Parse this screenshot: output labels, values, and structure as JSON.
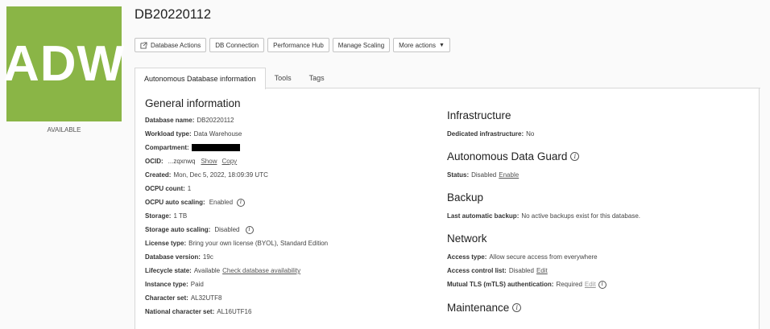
{
  "db": {
    "title": "DB20220112",
    "logo_text": "ADW",
    "lifecycle_badge": "AVAILABLE"
  },
  "toolbar": {
    "database_actions": "Database Actions",
    "db_connection": "DB Connection",
    "performance_hub": "Performance Hub",
    "manage_scaling": "Manage Scaling",
    "more_actions": "More actions"
  },
  "tabs": {
    "info": "Autonomous Database information",
    "tools": "Tools",
    "tags": "Tags"
  },
  "general": {
    "title": "General information",
    "database_name_label": "Database name:",
    "database_name": "DB20220112",
    "workload_type_label": "Workload type:",
    "workload_type": "Data Warehouse",
    "compartment_label": "Compartment:",
    "ocid_label": "OCID:",
    "ocid_value": "...zqxnwq",
    "ocid_show": "Show",
    "ocid_copy": "Copy",
    "created_label": "Created:",
    "created": "Mon, Dec 5, 2022, 18:09:39 UTC",
    "ocpu_count_label": "OCPU count:",
    "ocpu_count": "1",
    "ocpu_auto_scaling_label": "OCPU auto scaling:",
    "ocpu_auto_scaling": "Enabled",
    "storage_label": "Storage:",
    "storage": "1 TB",
    "storage_auto_scaling_label": "Storage auto scaling:",
    "storage_auto_scaling": "Disabled",
    "license_type_label": "License type:",
    "license_type": "Bring your own license (BYOL), Standard Edition",
    "database_version_label": "Database version:",
    "database_version": "19c",
    "lifecycle_state_label": "Lifecycle state:",
    "lifecycle_state": "Available",
    "check_availability": "Check database availability",
    "instance_type_label": "Instance type:",
    "instance_type": "Paid",
    "character_set_label": "Character set:",
    "character_set": "AL32UTF8",
    "national_character_set_label": "National character set:",
    "national_character_set": "AL16UTF16"
  },
  "infrastructure": {
    "title": "Infrastructure",
    "dedicated_label": "Dedicated infrastructure:",
    "dedicated": "No"
  },
  "data_guard": {
    "title": "Autonomous Data Guard",
    "status_label": "Status:",
    "status": "Disabled",
    "enable": "Enable"
  },
  "backup": {
    "title": "Backup",
    "last_label": "Last automatic backup:",
    "last": "No active backups exist for this database."
  },
  "network": {
    "title": "Network",
    "access_type_label": "Access type:",
    "access_type": "Allow secure access from everywhere",
    "acl_label": "Access control list:",
    "acl": "Disabled",
    "acl_edit": "Edit",
    "mtls_label": "Mutual TLS (mTLS) authentication:",
    "mtls": "Required",
    "mtls_edit": "Edit"
  },
  "maintenance": {
    "title": "Maintenance"
  },
  "colors": {
    "logo_green": "#8ab546"
  },
  "icons": {
    "info": "i"
  }
}
